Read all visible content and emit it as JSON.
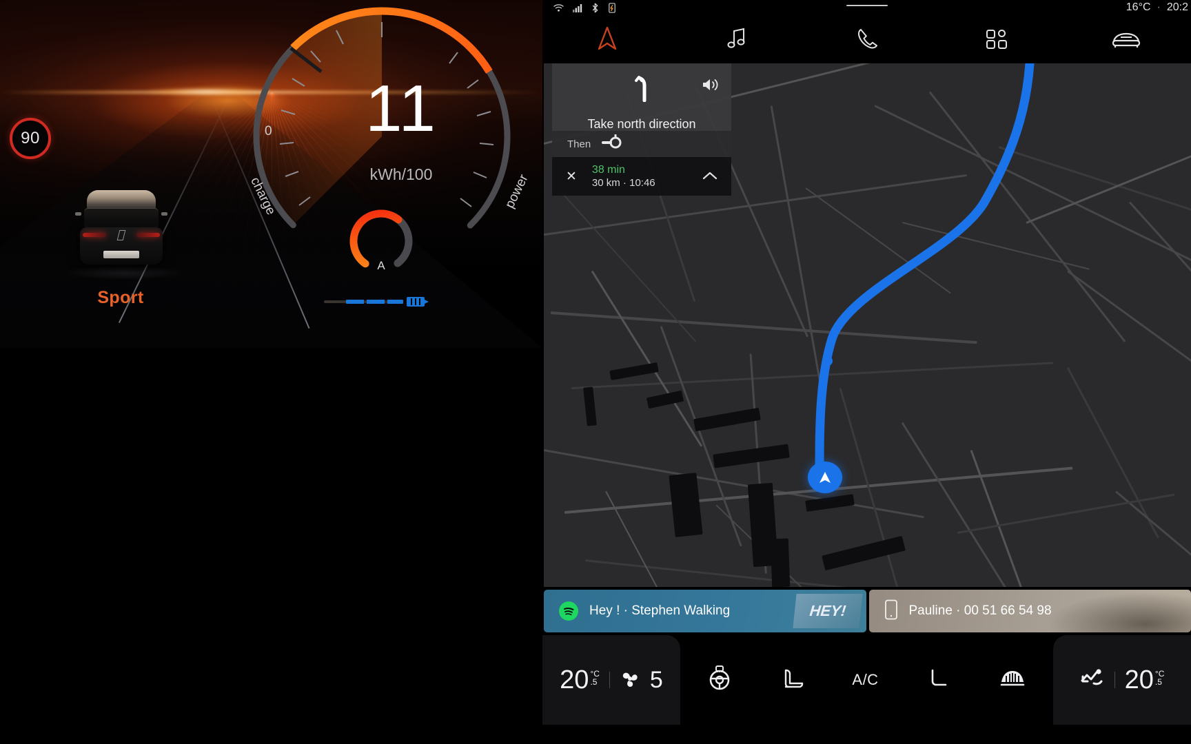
{
  "cluster": {
    "speed_limit": "90",
    "drive_mode": "Sport",
    "gauge": {
      "value": "11",
      "unit": "kWh/100",
      "zero_label": "0",
      "charge_label": "charge",
      "power_label": "power",
      "accent_color": "#f26322",
      "needle_percent": 62
    },
    "amp_gauge": {
      "label": "A",
      "fill_percent": 62
    },
    "battery": {
      "level_percent": 72,
      "color": "#1876d8"
    }
  },
  "ivi": {
    "statusbar": {
      "wifi_icon": "wifi-icon",
      "signal_icon": "cellular-signal-icon",
      "bluetooth_icon": "bluetooth-icon",
      "usb_icon": "usb-icon",
      "temperature": "16°C",
      "separator": "·",
      "time": "20:2"
    },
    "tabs": [
      {
        "name": "navigation",
        "icon": "navigation-arrow-icon",
        "active": true
      },
      {
        "name": "media",
        "icon": "music-note-icon",
        "active": false
      },
      {
        "name": "phone",
        "icon": "phone-handset-icon",
        "active": false
      },
      {
        "name": "apps",
        "icon": "apps-grid-icon",
        "active": false
      },
      {
        "name": "vehicle",
        "icon": "car-front-icon",
        "active": false
      }
    ],
    "nav_card": {
      "maneuver_icon": "turn-slight-left-icon",
      "sound_icon": "speaker-on-icon",
      "instruction": "Take north direction",
      "then_label": "Then",
      "then_icon": "roundabout-icon",
      "close_icon": "close-x-icon",
      "eta_time": "38 min",
      "eta_detail": "30 km · 10:46",
      "expand_icon": "chevron-up-icon"
    },
    "map": {
      "route_color": "#1a73e8",
      "position_icon": "navigation-puck-icon"
    },
    "widgets": [
      {
        "name": "media-widget",
        "icon": "spotify-icon",
        "label": "Hey ! · Stephen Walking",
        "art_text": "HEY!",
        "color": "#35779a"
      },
      {
        "name": "phone-widget",
        "icon": "smartphone-icon",
        "label": "Pauline · 00 51 66 54 98",
        "color": "#a9a096"
      }
    ],
    "climate": {
      "left": {
        "temp": "20",
        "unit": "°C",
        "decimal": ".5",
        "fan_icon": "fan-icon",
        "fan_speed": "5"
      },
      "right": {
        "temp": "20",
        "unit": "°C",
        "decimal": ".5",
        "airflow_icon": "airflow-auto-icon"
      },
      "controls": [
        {
          "name": "steering-wheel-heat",
          "icon": "steering-wheel-icon",
          "label": ""
        },
        {
          "name": "front-seat-heat",
          "icon": "seat-heat-icon",
          "label": ""
        },
        {
          "name": "ac-toggle",
          "icon": "",
          "label": "A/C"
        },
        {
          "name": "rear-seat-heat",
          "icon": "seat-icon",
          "label": ""
        },
        {
          "name": "rear-defrost",
          "icon": "rear-defrost-icon",
          "label": ""
        }
      ]
    }
  }
}
